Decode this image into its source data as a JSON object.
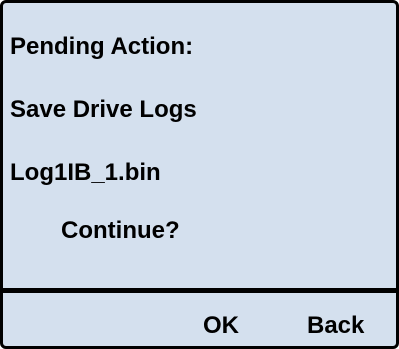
{
  "dialog": {
    "heading": "Pending Action:",
    "action": "Save Drive Logs",
    "filename": "Log1IB_1.bin",
    "prompt": "Continue?"
  },
  "softkeys": {
    "ok_label": "OK",
    "back_label": "Back"
  },
  "colors": {
    "background": "#d4e0ee",
    "text": "#000000",
    "border": "#000000"
  }
}
